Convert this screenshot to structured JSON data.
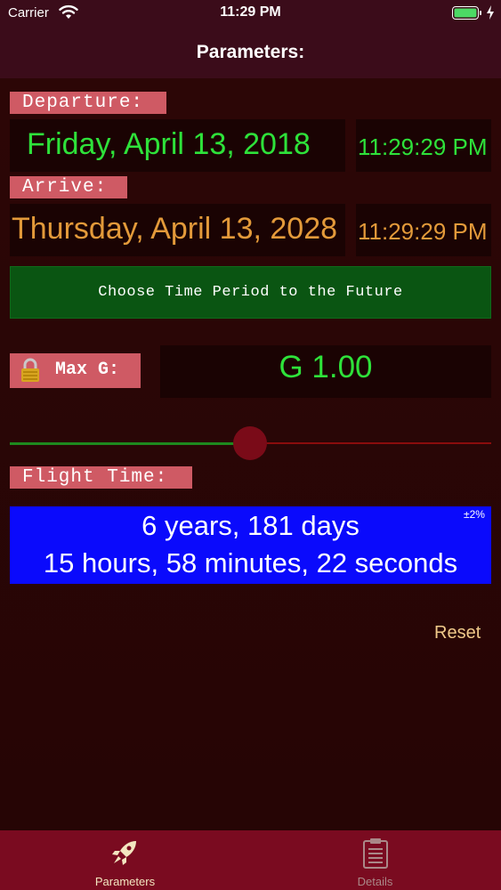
{
  "status_bar": {
    "carrier": "Carrier",
    "time": "11:29 PM"
  },
  "nav": {
    "title": "Parameters:"
  },
  "departure": {
    "label": "Departure:",
    "date": "Friday, April 13, 2018",
    "time": "11:29:29 PM"
  },
  "arrive": {
    "label": "Arrive:",
    "date": "Thursday, April 13, 2028",
    "time": "11:29:29 PM"
  },
  "choose_button": "Choose Time Period to the Future",
  "max_g": {
    "label": "Max G:",
    "value": "G 1.00",
    "lock_icon": "lock-icon"
  },
  "slider": {
    "level": 0.5
  },
  "flight_time": {
    "label": "Flight Time:",
    "line1": "6 years, 181 days",
    "line2": "15 hours, 58 minutes, 22 seconds",
    "tolerance": "±2%"
  },
  "reset_label": "Reset",
  "tabs": [
    {
      "label": "Parameters",
      "icon": "rocket-icon",
      "active": true
    },
    {
      "label": "Details",
      "icon": "clipboard-icon",
      "active": false
    }
  ],
  "colors": {
    "background": "#2a0606",
    "bar": "#3b0c1a",
    "tag": "#cf5a64",
    "green_text": "#2ee23a",
    "orange_text": "#e39a3a",
    "choose_button": "#0a5512",
    "flight_box": "#0a0afc",
    "tabbar": "#7a0b20"
  }
}
